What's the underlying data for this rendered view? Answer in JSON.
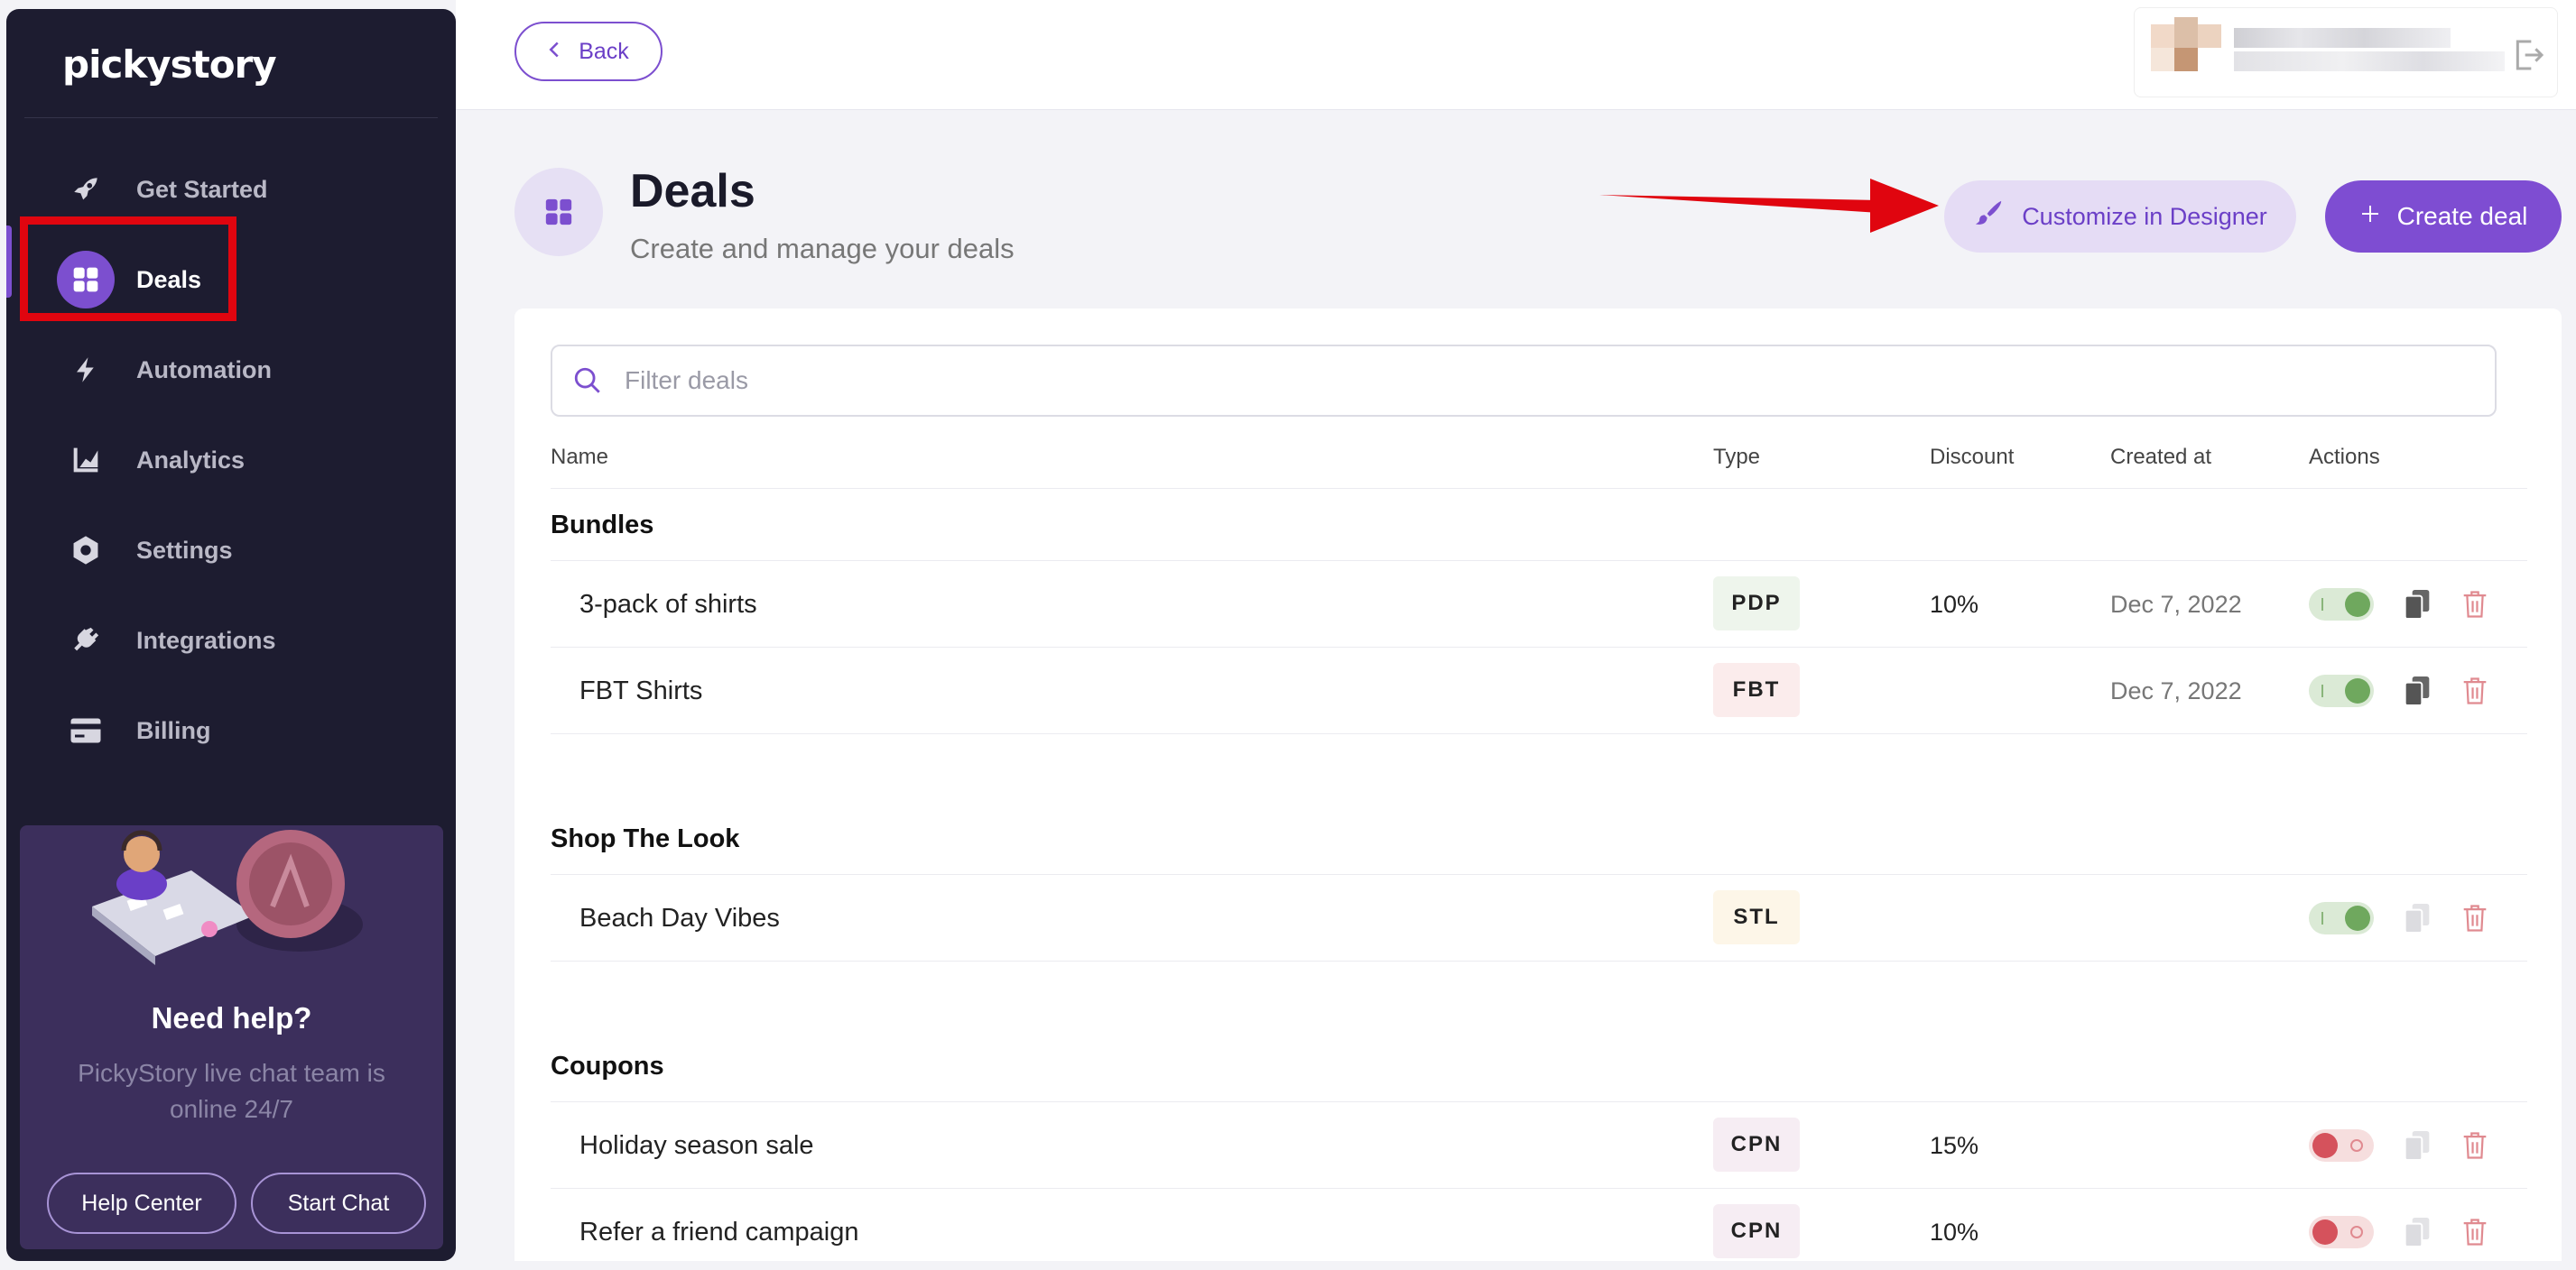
{
  "sidebar": {
    "logo_text": "pickystory",
    "items": [
      {
        "label": "Get Started",
        "icon": "rocket-icon"
      },
      {
        "label": "Deals",
        "icon": "grid-icon"
      },
      {
        "label": "Automation",
        "icon": "lightning-icon"
      },
      {
        "label": "Analytics",
        "icon": "chart-icon"
      },
      {
        "label": "Settings",
        "icon": "gear-icon"
      },
      {
        "label": "Integrations",
        "icon": "plug-icon"
      },
      {
        "label": "Billing",
        "icon": "credit-card-icon"
      }
    ],
    "active_item": "Deals",
    "help": {
      "title": "Need help?",
      "text": "PickyStory live chat team is online 24/7",
      "help_center_label": "Help Center",
      "start_chat_label": "Start Chat"
    }
  },
  "topbar": {
    "back_label": "Back"
  },
  "header": {
    "title": "Deals",
    "subtitle": "Create and manage your deals",
    "customize_label": "Customize in Designer",
    "create_label": "Create deal"
  },
  "filter": {
    "placeholder": "Filter deals"
  },
  "table": {
    "columns": [
      "Name",
      "Type",
      "Discount",
      "Created at",
      "Actions"
    ],
    "groups": [
      {
        "title": "Bundles",
        "rows": [
          {
            "name": "3-pack of shirts",
            "type": "PDP",
            "discount": "10%",
            "created": "Dec 7, 2022",
            "enabled": true
          },
          {
            "name": "FBT Shirts",
            "type": "FBT",
            "discount": "",
            "created": "Dec 7, 2022",
            "enabled": true
          }
        ]
      },
      {
        "title": "Shop The Look",
        "rows": [
          {
            "name": "Beach Day Vibes",
            "type": "STL",
            "discount": "",
            "created": "",
            "enabled": true
          }
        ]
      },
      {
        "title": "Coupons",
        "rows": [
          {
            "name": "Holiday season sale",
            "type": "CPN",
            "discount": "15%",
            "created": "",
            "enabled": false
          },
          {
            "name": "Refer a friend campaign",
            "type": "CPN",
            "discount": "10%",
            "created": "",
            "enabled": false
          }
        ]
      }
    ]
  },
  "colors": {
    "accent": "#7e4dd2",
    "sidebar_bg": "#1d1c30",
    "badge_pdp": "#eef5ec",
    "badge_fbt": "#fbecec",
    "badge_stl": "#fdf6e8",
    "badge_cpn": "#f6edf3",
    "annotation_red": "#e0050f"
  }
}
